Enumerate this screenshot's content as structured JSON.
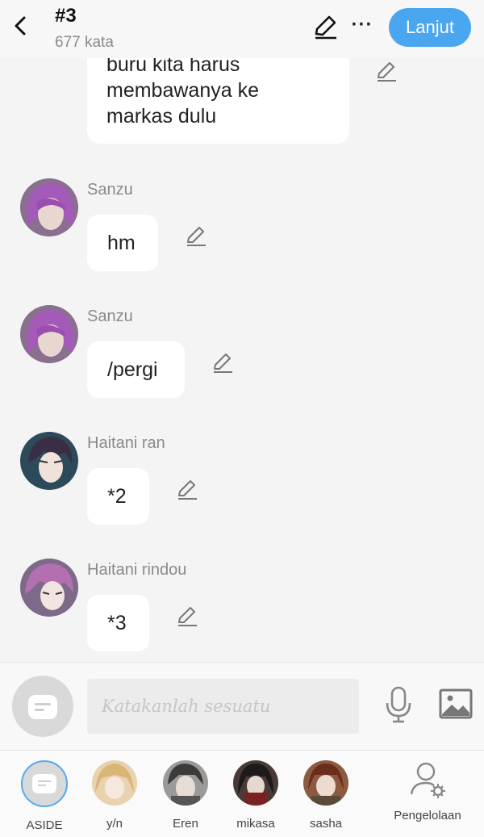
{
  "header": {
    "title": "#3",
    "word_count": "677 kata",
    "next_label": "Lanjut"
  },
  "messages": {
    "first_text_lines": [
      "buru kita harus",
      "membawanya ke",
      "markas dulu"
    ],
    "items": [
      {
        "name": "Sanzu",
        "text": "hm",
        "avatar_color": "#8a5a9c"
      },
      {
        "name": "Sanzu",
        "text": "/pergi",
        "avatar_color": "#8a5a9c"
      },
      {
        "name": "Haitani ran",
        "text": "*2",
        "avatar_color": "#3b3346"
      },
      {
        "name": "Haitani rindou",
        "text": "*3",
        "avatar_color": "#b07aa6"
      }
    ]
  },
  "composer": {
    "placeholder": "Katakanlah sesuatu"
  },
  "characters": [
    {
      "label": "ASIDE"
    },
    {
      "label": "y/n",
      "color": "#d7b98a"
    },
    {
      "label": "Eren",
      "color": "#7b7b7b"
    },
    {
      "label": "mikasa",
      "color": "#3a2a2a"
    },
    {
      "label": "sasha",
      "color": "#7a3d2a"
    }
  ],
  "manage_label": "Pengelolaan",
  "colors": {
    "accent": "#4aa6ee",
    "background": "#f4f4f4",
    "bubble": "#ffffff"
  }
}
